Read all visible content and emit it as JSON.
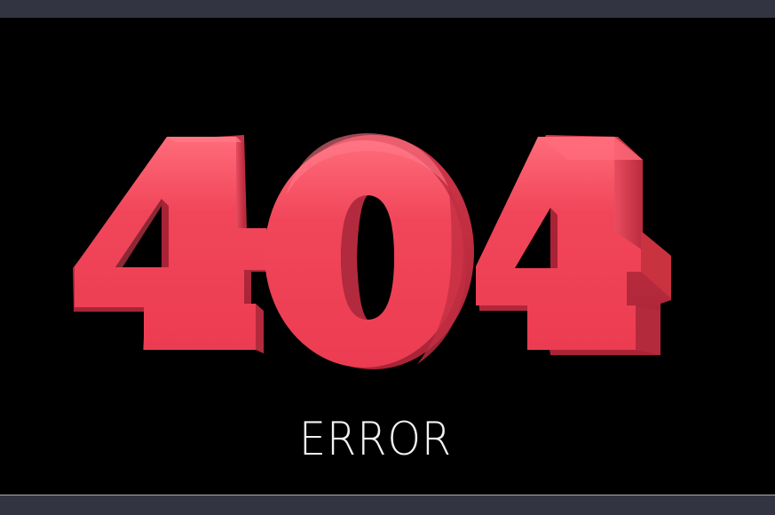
{
  "hero": {
    "code": "404",
    "label": "ERROR"
  },
  "colors": {
    "background": "#000000",
    "chrome": "#323541",
    "digit_face": "#f03d52",
    "digit_side": "#c52d42",
    "digit_shadow": "#8f1d2e",
    "label": "#f2f2f2"
  }
}
